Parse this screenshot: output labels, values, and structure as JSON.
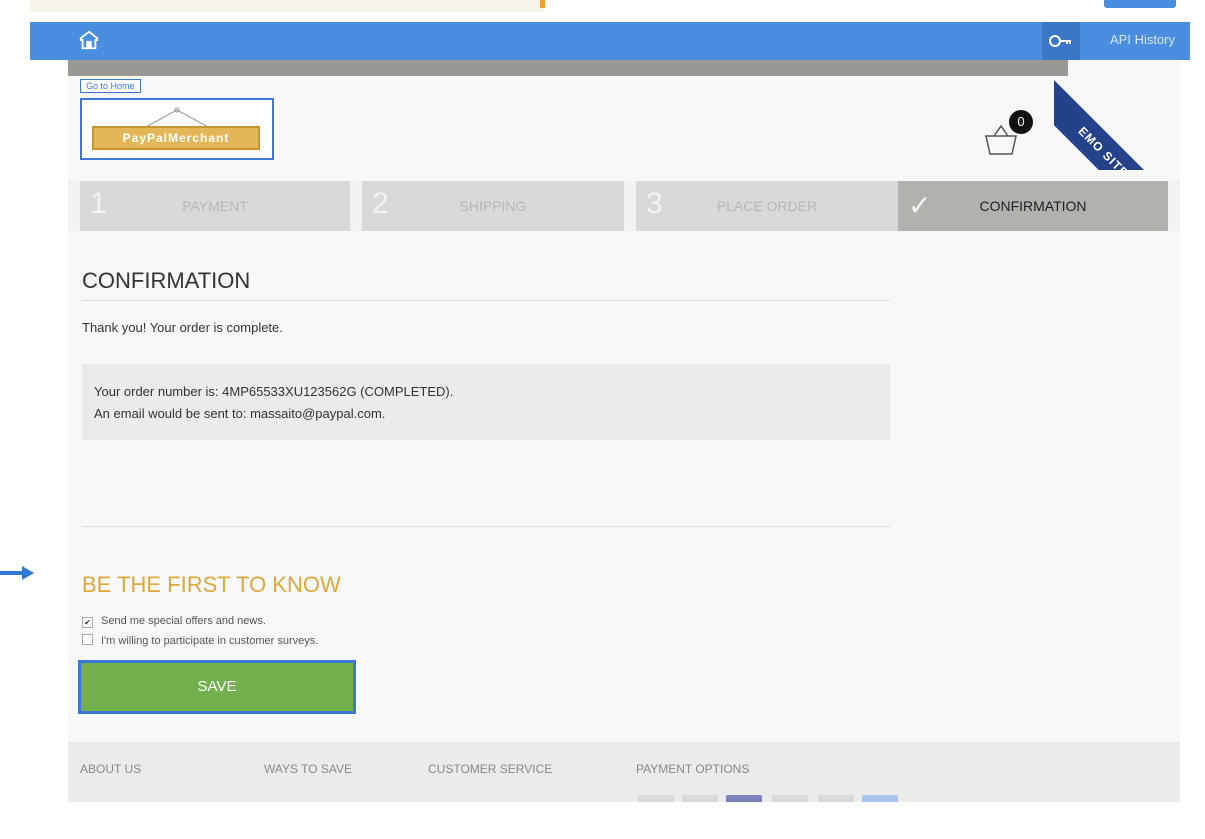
{
  "api_bar": {
    "api_history": "API History"
  },
  "ribbon": {
    "text": "EMO SITE"
  },
  "logo": {
    "link_label": "Go to Home",
    "brand": "PayPalMerchant"
  },
  "cart": {
    "count": "0"
  },
  "steps": [
    {
      "num": "1",
      "label": "PAYMENT"
    },
    {
      "num": "2",
      "label": "SHIPPING"
    },
    {
      "num": "3",
      "label": "PLACE ORDER"
    },
    {
      "num": "✓",
      "label": "CONFIRMATION"
    }
  ],
  "confirmation": {
    "title": "CONFIRMATION",
    "thanks": "Thank you! Your order is complete.",
    "order_line": "Your order number is: 4MP65533XU123562G (COMPLETED).",
    "email_line": "An email would be sent to: massaito@paypal.com."
  },
  "newsletter": {
    "title": "BE THE FIRST TO KNOW",
    "options": [
      {
        "label": "Send me special offers and news.",
        "checked": true
      },
      {
        "label": "I'm willing to participate in customer surveys.",
        "checked": false
      }
    ],
    "save_label": "SAVE"
  },
  "footer": {
    "columns": [
      "ABOUT US",
      "WAYS TO SAVE",
      "CUSTOMER SERVICE",
      "PAYMENT OPTIONS"
    ]
  },
  "colors": {
    "api_bar": "#4a8ee0",
    "ribbon": "#24418a",
    "newsletter_title": "#dfa83c",
    "save_button": "#72b04d",
    "highlight_border": "#3d78d8"
  }
}
